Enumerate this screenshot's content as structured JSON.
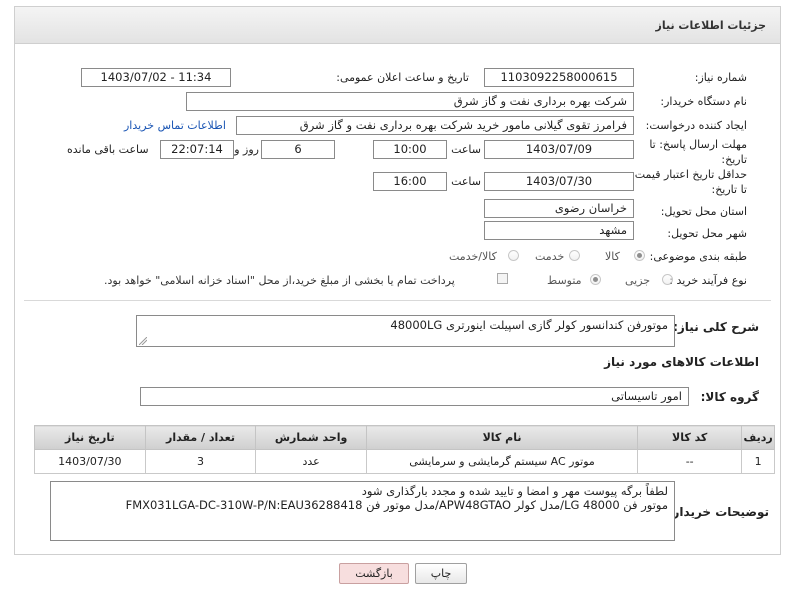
{
  "header": {
    "title": "جزئیات اطلاعات نیاز"
  },
  "need_number": {
    "label": "شماره نیاز:",
    "value": "1103092258000615"
  },
  "announce": {
    "label": "تاریخ و ساعت اعلان عمومی:",
    "value": "1403/07/02 - 11:34"
  },
  "buyer_org": {
    "label": "نام دستگاه خریدار:",
    "value": "شرکت بهره برداری نفت و گاز شرق"
  },
  "requester": {
    "label": "ایجاد کننده درخواست:",
    "value": "فرامرز تقوی گیلانی مامور خرید شرکت بهره برداری نفت و گاز شرق",
    "contact_link": "اطلاعات تماس خریدار"
  },
  "reply_deadline": {
    "label": "مهلت ارسال پاسخ: تا تاریخ:",
    "date": "1403/07/09",
    "time_label": "ساعت",
    "time": "10:00",
    "days": "6",
    "days_label": "روز و",
    "remaining": "22:07:14",
    "remaining_label": "ساعت باقی مانده"
  },
  "price_validity": {
    "label": "حداقل تاریخ اعتبار قیمت: تا تاریخ:",
    "date": "1403/07/30",
    "time_label": "ساعت",
    "time": "16:00"
  },
  "province": {
    "label": "استان محل تحویل:",
    "value": "خراسان رضوی"
  },
  "city": {
    "label": "شهر محل تحویل:",
    "value": "مشهد"
  },
  "category": {
    "label": "طبقه بندی موضوعی:",
    "options": [
      "کالا",
      "خدمت",
      "کالا/خدمت"
    ]
  },
  "process": {
    "label": "نوع فرآیند خرید :",
    "options": [
      "جزیی",
      "متوسط"
    ],
    "payment_note": "پرداخت تمام یا بخشی از مبلغ خرید،از محل \"اسناد خزانه اسلامی\" خواهد بود."
  },
  "description": {
    "label": "شرح کلی نیاز:",
    "value": "موتورفن کندانسور کولر گازی اسپیلت اینورتری 48000LG"
  },
  "goods_info": {
    "title": "اطلاعات کالاهای مورد نیاز"
  },
  "goods_group": {
    "label": "گروه کالا:",
    "value": "امور تاسیساتی"
  },
  "table": {
    "headers": [
      "ردیف",
      "کد کالا",
      "نام کالا",
      "واحد شمارش",
      "تعداد / مقدار",
      "تاریخ نیاز"
    ],
    "rows": [
      [
        "1",
        "--",
        "موتور AC سیستم گرمایشی و سرمایشی",
        "عدد",
        "3",
        "1403/07/30"
      ]
    ]
  },
  "buyer_notes": {
    "label": "توضیحات خریدار:",
    "line1": "لطفاً برگه پیوست مهر و امضا و تایید شده و مجدد بارگذاری شود",
    "line2": "موتور فن 48000 LG/مدل کولر APW48GTAO/مدل موتور فن FMX031LGA-DC-310W-P/N:EAU36288418"
  },
  "buttons": {
    "print": "چاپ",
    "back": "بازگشت"
  }
}
